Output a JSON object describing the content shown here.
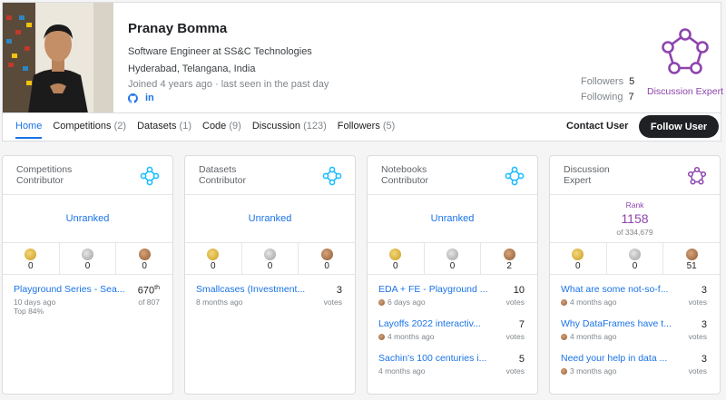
{
  "profile": {
    "name": "Pranay Bomma",
    "occupation": "Software Engineer at SS&C Technologies",
    "location": "Hyderabad, Telangana, India",
    "joined": "Joined 4 years ago · last seen in the past day",
    "social": {
      "github_icon": "github-icon",
      "linkedin_label": "in"
    },
    "followers_label": "Followers",
    "followers_count": "5",
    "following_label": "Following",
    "following_count": "7",
    "expert_tier": "Discussion Expert"
  },
  "nav": {
    "tabs": [
      {
        "label": "Home",
        "count": ""
      },
      {
        "label": "Competitions",
        "count": "(2)"
      },
      {
        "label": "Datasets",
        "count": "(1)"
      },
      {
        "label": "Code",
        "count": "(9)"
      },
      {
        "label": "Discussion",
        "count": "(123)"
      },
      {
        "label": "Followers",
        "count": "(5)"
      }
    ],
    "contact_label": "Contact User",
    "follow_label": "Follow User"
  },
  "colors": {
    "accent": "#1a73e8",
    "expert": "#8e44ad",
    "contributor_icon": "#20beff"
  },
  "cards": [
    {
      "title_line1": "Competitions",
      "title_line2": "Contributor",
      "icon": "contributor-tier-icon",
      "rank_text": "Unranked",
      "medals": {
        "gold": "0",
        "silver": "0",
        "bronze": "0"
      },
      "items": [
        {
          "title": "Playground Series - Sea...",
          "sub": "10 days ago",
          "sub2": "Top 84%",
          "value": "670",
          "value_sup": "th",
          "unit": "of 807"
        }
      ]
    },
    {
      "title_line1": "Datasets",
      "title_line2": "Contributor",
      "icon": "contributor-tier-icon",
      "rank_text": "Unranked",
      "medals": {
        "gold": "0",
        "silver": "0",
        "bronze": "0"
      },
      "items": [
        {
          "title": "Smallcases (Investment...",
          "sub": "8 months ago",
          "value": "3",
          "unit": "votes"
        }
      ]
    },
    {
      "title_line1": "Notebooks",
      "title_line2": "Contributor",
      "icon": "contributor-tier-icon",
      "rank_text": "Unranked",
      "medals": {
        "gold": "0",
        "silver": "0",
        "bronze": "2"
      },
      "items": [
        {
          "title": "EDA + FE - Playground ...",
          "sub": "6 days ago",
          "medal": "bronze",
          "value": "10",
          "unit": "votes"
        },
        {
          "title": "Layoffs 2022 interactiv...",
          "sub": "4 months ago",
          "medal": "bronze",
          "value": "7",
          "unit": "votes"
        },
        {
          "title": "Sachin's 100 centuries i...",
          "sub": "4 months ago",
          "value": "5",
          "unit": "votes"
        }
      ]
    },
    {
      "title_line1": "Discussion",
      "title_line2": "Expert",
      "icon": "expert-tier-icon",
      "rank_label": "Rank",
      "rank_value": "1158",
      "rank_of": "of 334,679",
      "medals": {
        "gold": "0",
        "silver": "0",
        "bronze": "51"
      },
      "items": [
        {
          "title": "What are some not-so-f...",
          "sub": "4 months ago",
          "medal": "bronze",
          "value": "3",
          "unit": "votes"
        },
        {
          "title": "Why DataFrames have t...",
          "sub": "4 months ago",
          "medal": "bronze",
          "value": "3",
          "unit": "votes"
        },
        {
          "title": "Need your help in data ...",
          "sub": "3 months ago",
          "medal": "bronze",
          "value": "3",
          "unit": "votes"
        }
      ]
    }
  ]
}
